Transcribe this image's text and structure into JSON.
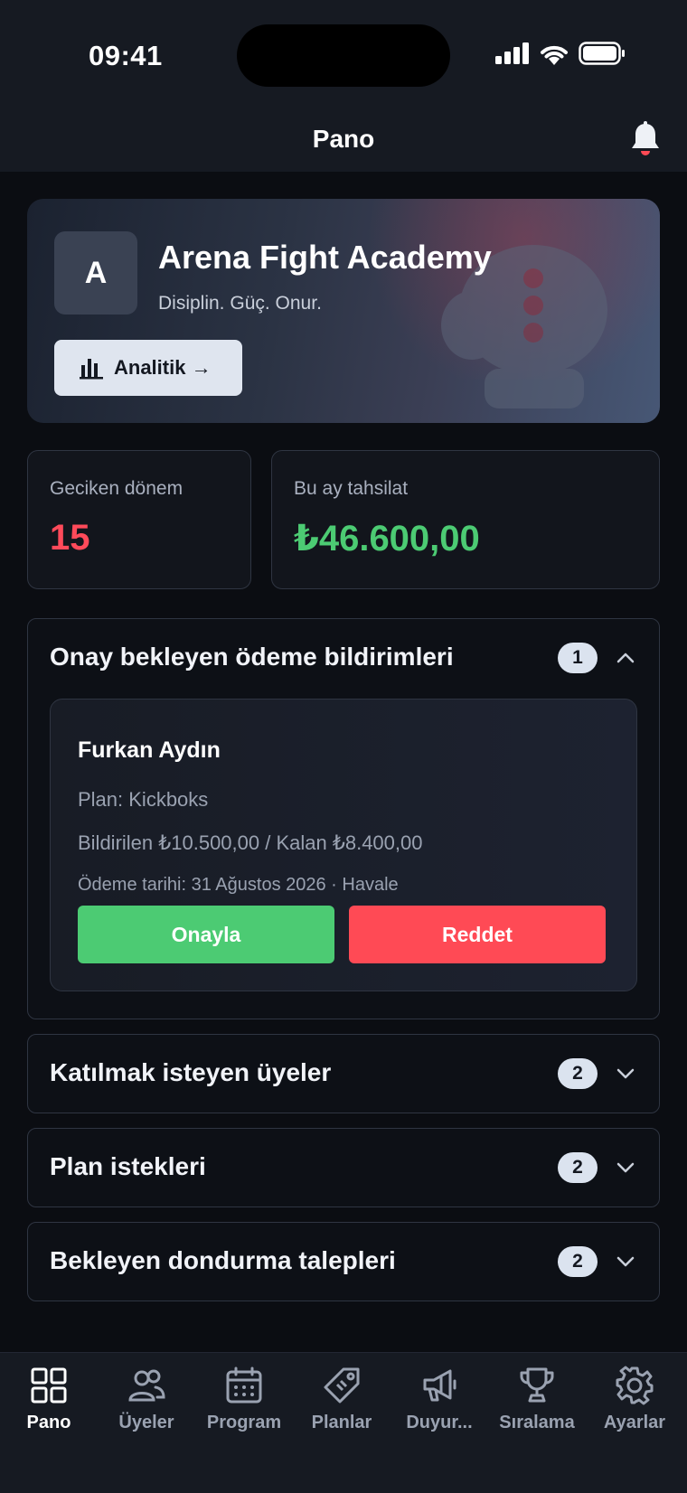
{
  "status_bar": {
    "time": "09:41"
  },
  "nav": {
    "title": "Pano"
  },
  "hero": {
    "avatar_letter": "A",
    "club_name": "Arena Fight Academy",
    "motto": "Disiplin. Güç. Onur.",
    "analytics_label": "Analitik →"
  },
  "stats": [
    {
      "label": "Geciken dönem",
      "value": "15",
      "color": "#ff4a5a"
    },
    {
      "label": "Bu ay tahsilat",
      "value": "₺46.600,00",
      "color": "#4ccb73"
    }
  ],
  "pending_payments": {
    "title": "Onay bekleyen ödeme bildirimleri",
    "count": "1",
    "expanded": true,
    "item": {
      "name": "Furkan Aydın",
      "plan": "Plan: Kickboks",
      "amounts": "Bildirilen ₺10.500,00 / Kalan ₺8.400,00",
      "date": "Ödeme tarihi: 31 Ağustos 2026 · Havale",
      "approve_label": "Onayla",
      "reject_label": "Reddet"
    }
  },
  "sections": [
    {
      "title": "Katılmak isteyen üyeler",
      "count": "2"
    },
    {
      "title": "Plan istekleri",
      "count": "2"
    },
    {
      "title": "Bekleyen dondurma talepleri",
      "count": "2"
    }
  ],
  "tabs": [
    {
      "label": "Pano",
      "icon": "grid-icon",
      "active": true
    },
    {
      "label": "Üyeler",
      "icon": "users-icon"
    },
    {
      "label": "Program",
      "icon": "calendar-icon"
    },
    {
      "label": "Planlar",
      "icon": "tag-icon"
    },
    {
      "label": "Duyur...",
      "icon": "megaphone-icon"
    },
    {
      "label": "Sıralama",
      "icon": "trophy-icon"
    },
    {
      "label": "Ayarlar",
      "icon": "gear-icon"
    }
  ],
  "colors": {
    "accent_green": "#4ccb73",
    "accent_red": "#ff4a55",
    "background": "#0b0d12"
  }
}
